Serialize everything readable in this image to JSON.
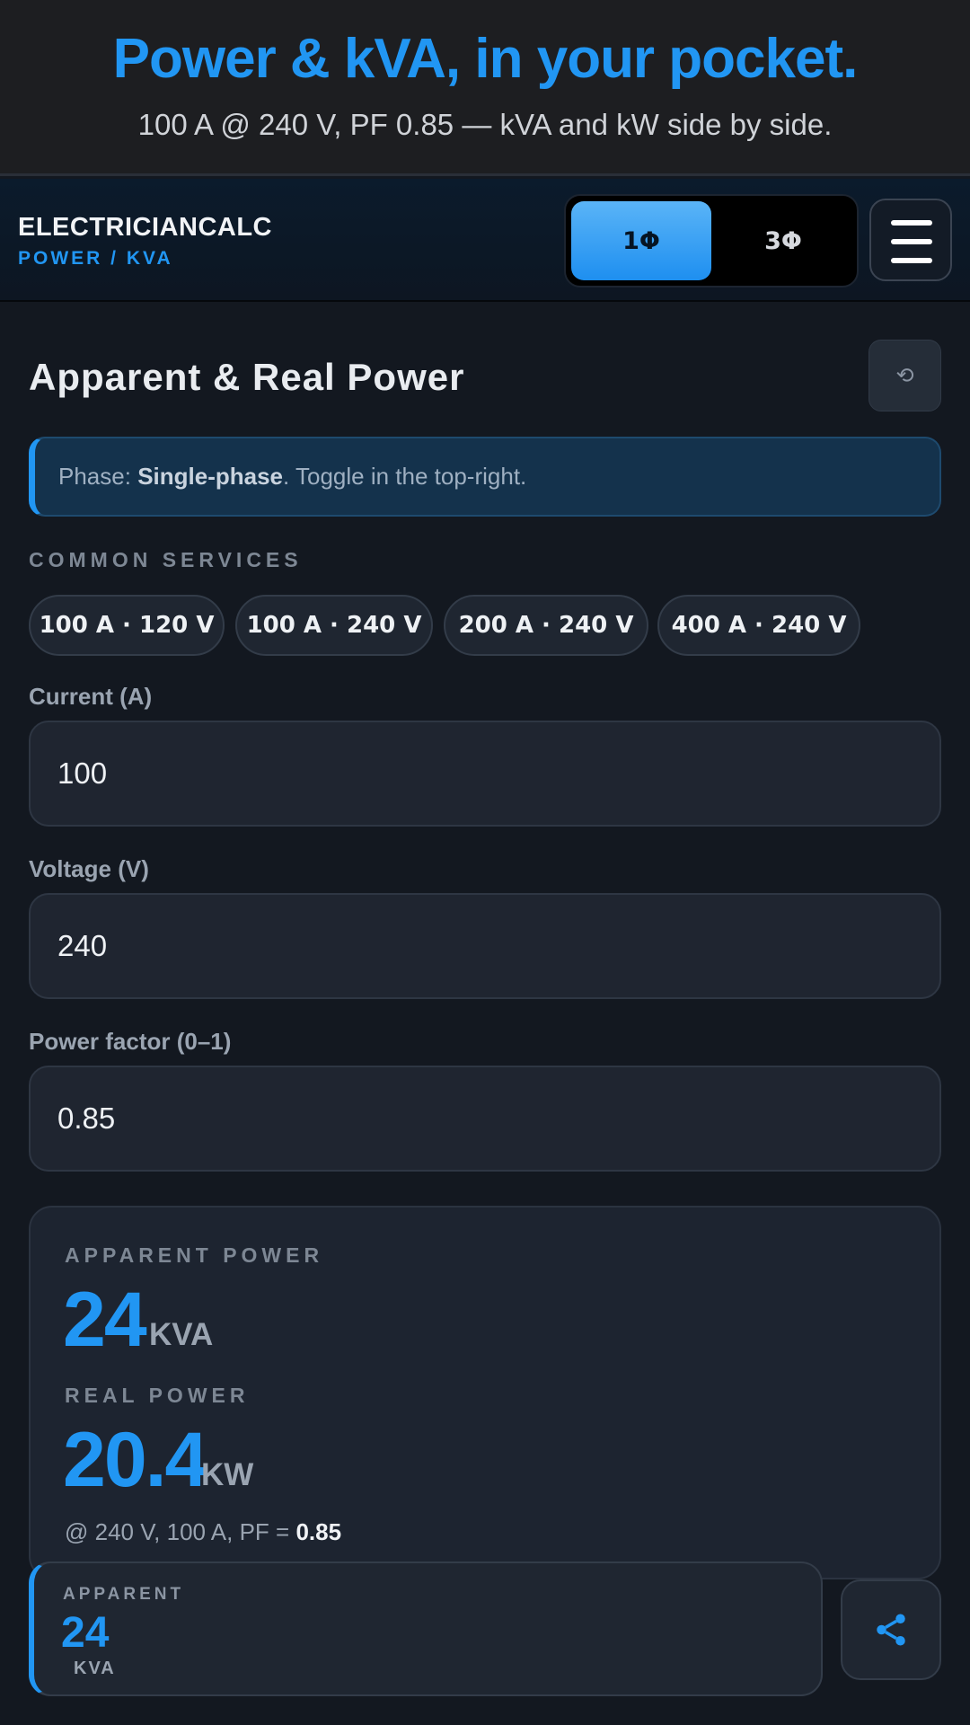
{
  "promo": {
    "title": "Power & kVA, in your pocket.",
    "subtitle": "100 A @ 240 V, PF 0.85 — kVA and kW side by side."
  },
  "appbar": {
    "brand_name": "ELECTRICIANCALC",
    "brand_sub": "POWER / KVA",
    "phase_options": [
      "1Φ",
      "3Φ"
    ],
    "active_phase": "1Φ",
    "menu_icon": "hamburger-icon"
  },
  "main": {
    "title": "Apparent & Real Power",
    "reset_icon": "reset-icon",
    "reset_glyph": "⟲",
    "info": {
      "prefix": "Phase: ",
      "phase": "Single-phase",
      "suffix": ". Toggle in the top-right."
    },
    "services_label": "COMMON SERVICES",
    "services": [
      "100 A · 120 V",
      "100 A · 240 V",
      "200 A · 240 V",
      "400 A · 240 V"
    ],
    "fields": {
      "current": {
        "label": "Current (A)",
        "value": "100"
      },
      "voltage": {
        "label": "Voltage (V)",
        "value": "240"
      },
      "pf": {
        "label": "Power factor (0–1)",
        "value": "0.85"
      }
    }
  },
  "results": {
    "apparent_label": "APPARENT POWER",
    "apparent_value": "24",
    "apparent_unit": "KVA",
    "real_label": "REAL POWER",
    "real_value": "20.4",
    "real_unit": "KW",
    "foot_prefix": "@ 240 V, 100 A, PF = ",
    "foot_pf": "0.85"
  },
  "sticky": {
    "label": "APPARENT",
    "value": "24",
    "unit": "KVA",
    "share_icon": "share-icon"
  },
  "colors": {
    "accent": "#2196f3",
    "background": "#131820",
    "card": "#1d2430"
  }
}
